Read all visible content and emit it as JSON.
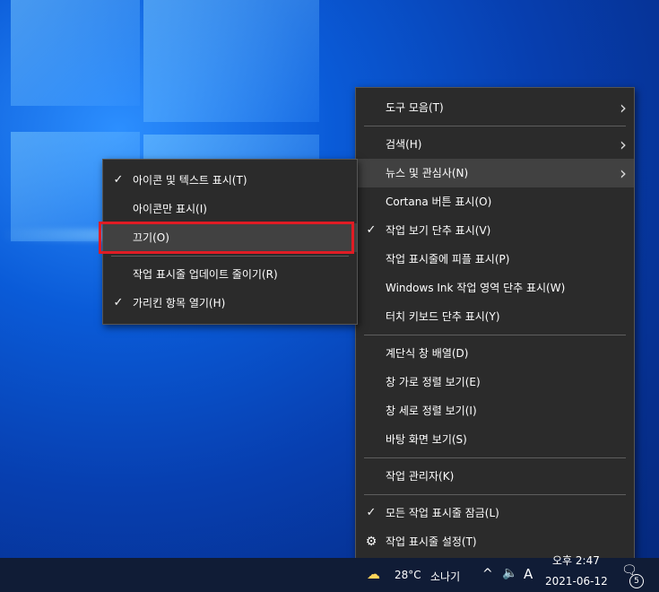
{
  "main_menu": {
    "items": [
      {
        "label": "도구 모음(T)",
        "submenu": true
      },
      {
        "sep": true
      },
      {
        "label": "검색(H)",
        "submenu": true
      },
      {
        "label": "뉴스 및 관심사(N)",
        "submenu": true,
        "highlighted": true
      },
      {
        "label": "Cortana 버튼 표시(O)"
      },
      {
        "label": "작업 보기 단추 표시(V)",
        "checked": true
      },
      {
        "label": "작업 표시줄에 피플 표시(P)"
      },
      {
        "label": "Windows Ink 작업 영역 단추 표시(W)"
      },
      {
        "label": "터치 키보드 단추 표시(Y)"
      },
      {
        "sep": true
      },
      {
        "label": "계단식 창 배열(D)"
      },
      {
        "label": "창 가로 정렬 보기(E)"
      },
      {
        "label": "창 세로 정렬 보기(I)"
      },
      {
        "label": "바탕 화면 보기(S)"
      },
      {
        "sep": true
      },
      {
        "label": "작업 관리자(K)"
      },
      {
        "sep": true
      },
      {
        "label": "모든 작업 표시줄 잠금(L)",
        "checked": true
      },
      {
        "label": "작업 표시줄 설정(T)",
        "icon": "gear-icon"
      }
    ]
  },
  "submenu": {
    "items": [
      {
        "label": "아이콘 및 텍스트 표시(T)",
        "checked": true
      },
      {
        "label": "아이콘만 표시(I)"
      },
      {
        "label": "끄기(O)",
        "highlighted": true
      },
      {
        "sep": true
      },
      {
        "label": "작업 표시줄 업데이트 줄이기(R)"
      },
      {
        "label": "가리킨 항목 열기(H)",
        "checked": true
      }
    ]
  },
  "taskbar": {
    "weather_icon": "cloud-rain-sun-icon",
    "temperature": "28°C",
    "weather_text": "소나기",
    "chevron": "^",
    "volume_icon": "speaker-icon",
    "ime": "A",
    "time": "오후 2:47",
    "date": "2021-06-12",
    "notification_count": "5"
  },
  "colors": {
    "menu_bg": "#2b2b2b",
    "menu_highlight": "#414141",
    "annotation_red": "#e01c24",
    "taskbar_bg": "#101c36"
  }
}
